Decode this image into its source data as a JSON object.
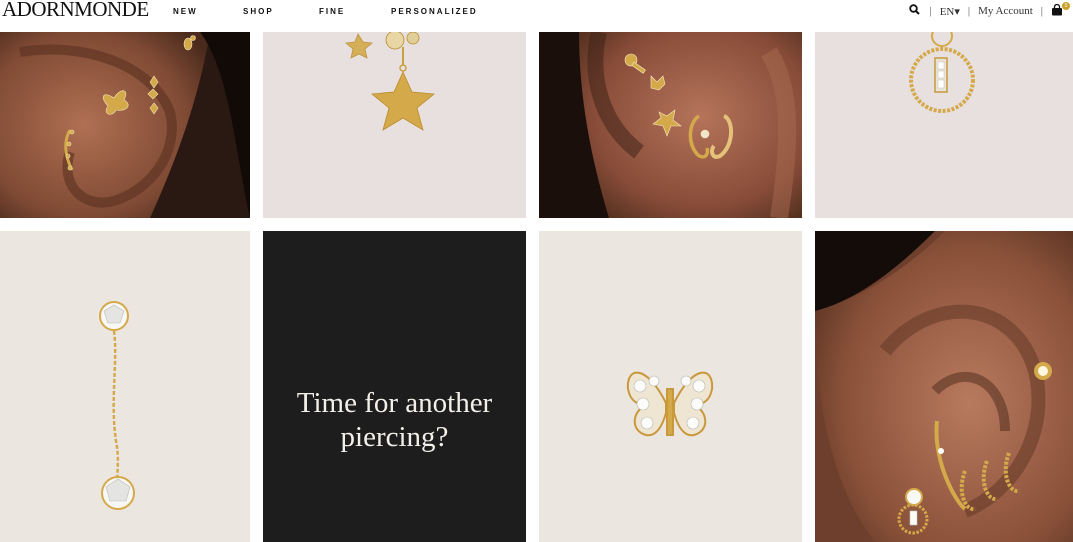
{
  "brand": {
    "logo_text": "ADORNMONDE"
  },
  "nav": {
    "items": [
      {
        "id": "new",
        "label": "NEW"
      },
      {
        "id": "shop",
        "label": "SHOP"
      },
      {
        "id": "fine",
        "label": "FINE"
      },
      {
        "id": "personalized",
        "label": "PERSONALIZED"
      }
    ]
  },
  "utility": {
    "language": "EN▾",
    "separator": "|",
    "account": "My Account",
    "cart_count": "0",
    "icons": [
      "search-icon",
      "shopping-bag-icon"
    ]
  },
  "grid": {
    "tiles": [
      {
        "name": "ear-stack-butterfly",
        "kind": "model-photo"
      },
      {
        "name": "star-charm-earring",
        "kind": "product-photo"
      },
      {
        "name": "ear-stack-key-cross",
        "kind": "model-photo"
      },
      {
        "name": "beaded-hoop-charm",
        "kind": "product-photo"
      },
      {
        "name": "diamond-drop-chain-earring",
        "kind": "product-photo"
      },
      {
        "name": "promo",
        "kind": "text"
      },
      {
        "name": "butterfly-stud",
        "kind": "product-photo"
      },
      {
        "name": "ear-stack-rings",
        "kind": "model-photo"
      }
    ],
    "promo_text": "Time for another piercing?"
  },
  "colors": {
    "gold": "#d4a94a",
    "tile_bg_pink": "#e8e0df",
    "tile_bg_cream": "#ece6e0",
    "promo_bg": "#1d1d1d",
    "skin_dark": "#7a4a37"
  }
}
